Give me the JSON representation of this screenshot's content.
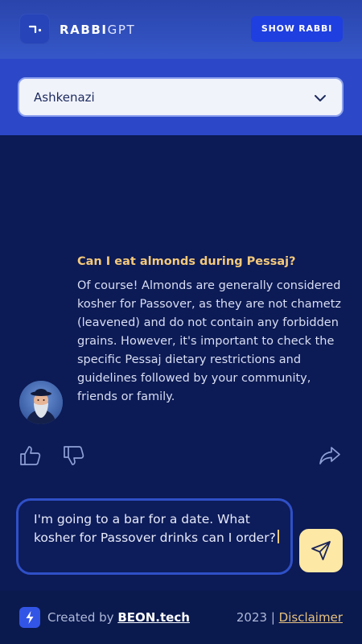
{
  "header": {
    "logo_bold": "RABBI",
    "logo_light": "GPT",
    "show_rabbi_label": "SHOW RABBI"
  },
  "tradition_select": {
    "value": "Ashkenazi",
    "icon": "chevron-down-icon"
  },
  "chat": {
    "question": "Can I eat almonds during Pessaj?",
    "answer": "Of course! Almonds are generally considered kosher for Passover, as they are not chametz (leavened) and do not contain any forbidden grains. However, it's important to check the specific Pessaj dietary restrictions and guidelines followed by your community, friends or family.",
    "avatar": "rabbi-avatar",
    "actions": [
      "thumbs-up-icon",
      "thumbs-down-icon",
      "share-icon"
    ]
  },
  "composer": {
    "value": "I'm going to a bar for a date. What kosher for Passover drinks can I order?",
    "send_icon": "send-icon"
  },
  "footer": {
    "created_by": "Created by",
    "brand": "BEON.tech",
    "year": "2023 |",
    "disclaimer": "Disclaimer"
  },
  "colors": {
    "accent": "#1f3fe0",
    "question": "#f4c97a",
    "send_button": "#fde8a6",
    "background": "#0c1a55"
  }
}
